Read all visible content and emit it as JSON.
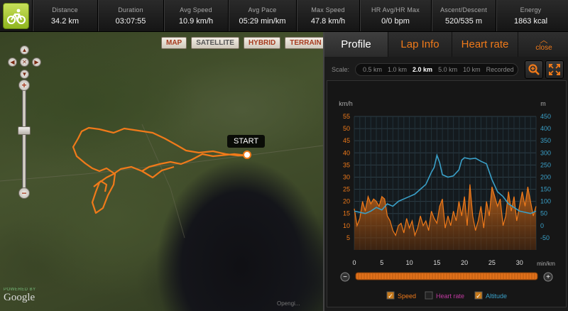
{
  "stats": [
    {
      "label": "Distance",
      "value": "34.2 km",
      "w": 92
    },
    {
      "label": "Duration",
      "value": "03:07:55",
      "w": 93
    },
    {
      "label": "Avg Speed",
      "value": "10.9 km/h",
      "w": 91
    },
    {
      "label": "Avg Pace",
      "value": "05:29 min/km",
      "w": 96
    },
    {
      "label": "Max Speed",
      "value": "47.8 km/h",
      "w": 89
    },
    {
      "label": "HR Avg/HR Max",
      "value": "0/0 bpm",
      "w": 101
    },
    {
      "label": "Ascent/Descent",
      "value": "520/535 m",
      "w": 91
    },
    {
      "label": "Energy",
      "value": "1863 kcal",
      "w": 98
    }
  ],
  "map": {
    "type_buttons": [
      "MAP",
      "SATELLITE",
      "HYBRID",
      "TERRAIN"
    ],
    "start_label": "START",
    "powered_by": "POWERED BY",
    "google": "Google",
    "attribution": "Opengi..."
  },
  "tabs": {
    "profile": "Profile",
    "lap_info": "Lap Info",
    "heart_rate": "Heart rate",
    "close": "close"
  },
  "scale": {
    "label": "Scale:",
    "options": [
      "0.5 km",
      "1.0 km",
      "2.0 km",
      "5.0 km",
      "10 km",
      "Recorded"
    ],
    "selected": "2.0 km"
  },
  "icons": {
    "app": "cyclist-icon",
    "zoom": "magnifier-icon",
    "fullscreen": "expand-icon"
  },
  "colors": {
    "speed": "#f07a1a",
    "altitude": "#3aa0c8",
    "heart_rate": "#c03aa0",
    "accent": "#f07a1a"
  },
  "legend": {
    "speed": {
      "label": "Speed",
      "checked": true
    },
    "heart_rate": {
      "label": "Heart rate",
      "checked": false
    },
    "altitude": {
      "label": "Altitude",
      "checked": true
    }
  },
  "chart_data": {
    "type": "area",
    "left_unit": "km/h",
    "right_unit": "m",
    "x_unit": "min/km",
    "xlim": [
      0,
      33
    ],
    "x_ticks": [
      0,
      5,
      10,
      15,
      20,
      25,
      30
    ],
    "y_left_ticks": [
      5,
      10,
      15,
      20,
      25,
      30,
      35,
      40,
      45,
      50,
      55
    ],
    "y_left_lim": [
      0,
      55
    ],
    "y_right_ticks": [
      -50,
      0,
      50,
      100,
      150,
      200,
      250,
      300,
      350,
      400,
      450
    ],
    "y_right_lim": [
      -100,
      450
    ],
    "grid": true,
    "series": [
      {
        "name": "Speed",
        "axis": "left",
        "x": [
          0,
          0.5,
          1,
          1.5,
          2,
          2.5,
          3,
          3.5,
          4,
          4.5,
          5,
          5.5,
          6,
          6.5,
          7,
          7.5,
          8,
          8.5,
          9,
          9.5,
          10,
          10.5,
          11,
          11.5,
          12,
          12.5,
          13,
          13.5,
          14,
          14.5,
          15,
          15.5,
          16,
          16.5,
          17,
          17.5,
          18,
          18.5,
          19,
          19.5,
          20,
          20.5,
          21,
          21.5,
          22,
          22.5,
          23,
          23.5,
          24,
          24.5,
          25,
          25.5,
          26,
          26.5,
          27,
          27.5,
          28,
          28.5,
          29,
          29.5,
          30,
          30.5,
          31,
          31.5,
          32,
          32.5,
          33
        ],
        "values": [
          17,
          10,
          13,
          20,
          16,
          22,
          19,
          21,
          20,
          18,
          22,
          21,
          14,
          12,
          8,
          6,
          10,
          11,
          7,
          13,
          9,
          12,
          6,
          9,
          14,
          10,
          12,
          8,
          16,
          13,
          11,
          18,
          21,
          9,
          14,
          10,
          16,
          12,
          20,
          14,
          22,
          10,
          27,
          14,
          8,
          12,
          18,
          9,
          20,
          14,
          26,
          22,
          18,
          21,
          10,
          14,
          24,
          16,
          22,
          12,
          18,
          24,
          18,
          26,
          20,
          14,
          18
        ]
      },
      {
        "name": "Altitude",
        "axis": "right",
        "x": [
          0,
          1,
          2,
          3,
          4,
          5,
          6,
          7,
          8,
          9,
          10,
          11,
          12,
          13,
          14,
          14.5,
          15,
          15.5,
          16,
          17,
          18,
          19,
          19.5,
          20,
          21,
          22,
          23,
          24,
          25,
          26,
          27,
          28,
          29,
          30,
          31,
          32,
          33
        ],
        "values": [
          60,
          55,
          50,
          60,
          75,
          65,
          90,
          80,
          100,
          110,
          120,
          130,
          150,
          170,
          220,
          240,
          290,
          260,
          210,
          200,
          205,
          230,
          270,
          280,
          275,
          278,
          265,
          255,
          190,
          140,
          120,
          90,
          75,
          60,
          55,
          50,
          60
        ]
      }
    ]
  }
}
